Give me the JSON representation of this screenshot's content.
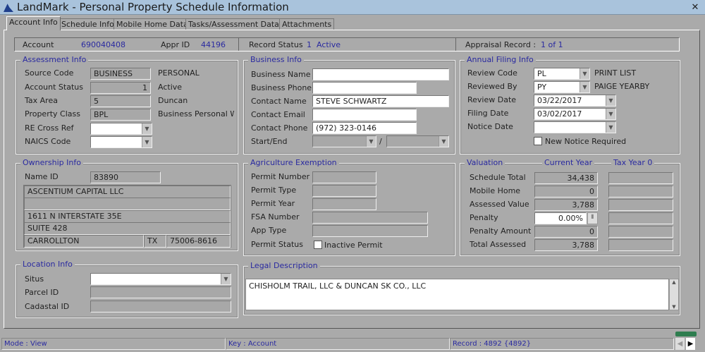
{
  "window": {
    "title": "LandMark - Personal Property Schedule Information",
    "close": "✕"
  },
  "tabs": [
    "Account Info",
    "Schedule Info",
    "Mobile Home Data",
    "Tasks/Assessment Data",
    "Attachments"
  ],
  "header": {
    "account_label": "Account",
    "account": "690040408",
    "appr_label": "Appr ID",
    "appr": "44196",
    "status_label": "Record Status",
    "status": "1  Active",
    "appraisal_label": "Appraisal Record :",
    "appraisal": "1 of 1"
  },
  "assessment": {
    "title": "Assessment Info",
    "source_label": "Source Code",
    "source": "BUSINESS",
    "source_desc": "PERSONAL",
    "status_label": "Account Status",
    "status": "1",
    "status_desc": "Active",
    "tax_label": "Tax Area",
    "tax": "5",
    "tax_desc": "Duncan",
    "class_label": "Property Class",
    "class": "BPL",
    "class_desc": "Business Personal W",
    "re_label": "RE Cross Ref",
    "re": "",
    "naics_label": "NAICS Code",
    "naics": ""
  },
  "business": {
    "title": "Business Info",
    "name_label": "Business Name",
    "name": "",
    "phone_label": "Business Phone",
    "phone": "",
    "contact_label": "Contact Name",
    "contact": "STEVE SCHWARTZ",
    "email_label": "Contact Email",
    "email": "",
    "cphone_label": "Contact Phone",
    "cphone": "(972) 323-0146",
    "startend_label": "Start/End",
    "sep": "/"
  },
  "filing": {
    "title": "Annual Filing Info",
    "review_code_label": "Review Code",
    "review_code": "PL",
    "review_code_desc": "PRINT LIST",
    "reviewed_by_label": "Reviewed By",
    "reviewed_by": "PY",
    "reviewed_by_desc": "PAIGE YEARBY",
    "review_date_label": "Review Date",
    "review_date": "03/22/2017",
    "filing_date_label": "Filing Date",
    "filing_date": "03/02/2017",
    "notice_label": "Notice Date",
    "notice": "",
    "new_notice": "New Notice Required"
  },
  "ownership": {
    "title": "Ownership Info",
    "name_id_label": "Name ID",
    "name_id": "83890",
    "line1": "ASCENTIUM CAPITAL LLC",
    "line2": "",
    "line3": "1611 N INTERSTATE 35E",
    "line4": "SUITE 428",
    "city": "CARROLLTON",
    "state": "TX",
    "zip": "75006-8616"
  },
  "agri": {
    "title": "Agriculture Exemption",
    "permit_number": "Permit Number",
    "permit_type": "Permit Type",
    "permit_year": "Permit Year",
    "fsa": "FSA Number",
    "app_type": "App Type",
    "permit_status": "Permit Status",
    "inactive": "Inactive Permit"
  },
  "valuation": {
    "title": "Valuation",
    "current": "Current Year",
    "tax_year": "Tax Year 0",
    "rows": [
      {
        "label": "Schedule Total",
        "value": "34,438"
      },
      {
        "label": "Mobile Home",
        "value": "0"
      },
      {
        "label": "Assessed Value",
        "value": "3,788"
      },
      {
        "label": "Penalty",
        "value": "0.00%"
      },
      {
        "label": "Penalty Amount",
        "value": "0"
      },
      {
        "label": "Total Assessed",
        "value": "3,788"
      }
    ]
  },
  "location": {
    "title": "Location Info",
    "situs": "Situs",
    "parcel": "Parcel ID",
    "cadastal": "Cadastal ID"
  },
  "legal": {
    "title": "Legal Description",
    "text": "CHISHOLM TRAIL, LLC & DUNCAN SK CO., LLC"
  },
  "statusbar": {
    "mode": "Mode : View",
    "key": "Key : Account",
    "record": "Record : 4892 {4892}"
  }
}
